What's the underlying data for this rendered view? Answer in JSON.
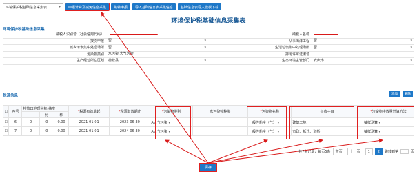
{
  "toolbar": {
    "select_value": "环境保护税基础信息采集表",
    "buttons": [
      "申报计算及减免信息采集",
      "跳转申报",
      "导入基础信息表采集信息",
      "基础信息表导入模板下载"
    ]
  },
  "title": "环境保护税基础信息采集表",
  "form_section": "环境保护税基础信息采集",
  "form": {
    "rows": [
      {
        "l1": "纳税人识别号（社会信用代码）",
        "v1": "",
        "l2": "纳税人名称",
        "v2": ""
      },
      {
        "l1": "按次申报",
        "v1": "否",
        "l2": "从事海洋工程",
        "v2": "否"
      },
      {
        "l1": "城乡污水集中处理场所",
        "v1": "否",
        "l2": "生活垃圾集中处理场所",
        "v2": "否"
      },
      {
        "l1": "污染物类别",
        "v1": "水污染,大气污染",
        "l2": "排污许可证编号",
        "v2": ""
      },
      {
        "l1": "生产经营所在区划",
        "v1": "德松县",
        "l2": "生态环境主管部门",
        "v2": "安庆市"
      }
    ]
  },
  "tax_section": "税源信息",
  "actions": {
    "add": "添加",
    "delete": "删除"
  },
  "table": {
    "headers": {
      "index": "序号",
      "coord": "排放口地理坐标-纬度",
      "min": "分",
      "sec": "秒",
      "start": "税源有效期起",
      "end": "税源有效期止",
      "cat": "污染物类别",
      "water": "水污染物种类",
      "name": "污染物名称",
      "levy": "征收子目",
      "calc": "污染物排放量计算方法"
    },
    "rows": [
      {
        "idx": "6",
        "deg": "0",
        "min": "0",
        "sec": "0.00",
        "start": "2021-01-01",
        "end": "2023-06-30",
        "cat": "A大气污染",
        "water": "",
        "name": "一般性粉尘（气）",
        "levy": "建筑工地",
        "calc": "抽样测算"
      },
      {
        "idx": "7",
        "deg": "0",
        "min": "0",
        "sec": "0.00",
        "start": "2021-01-01",
        "end": "2024-06-30",
        "cat": "A大气污染",
        "water": "",
        "name": "一般性粉尘（气）",
        "levy": "市政、拆迁、道桥",
        "calc": "抽样测算"
      }
    ]
  },
  "pager": {
    "total": "共7条记录，每页5条",
    "first": "首页",
    "prev": "上一页",
    "p1": "1",
    "p2": "2",
    "jump": "跳转到第",
    "page": "页"
  },
  "save": "保存"
}
